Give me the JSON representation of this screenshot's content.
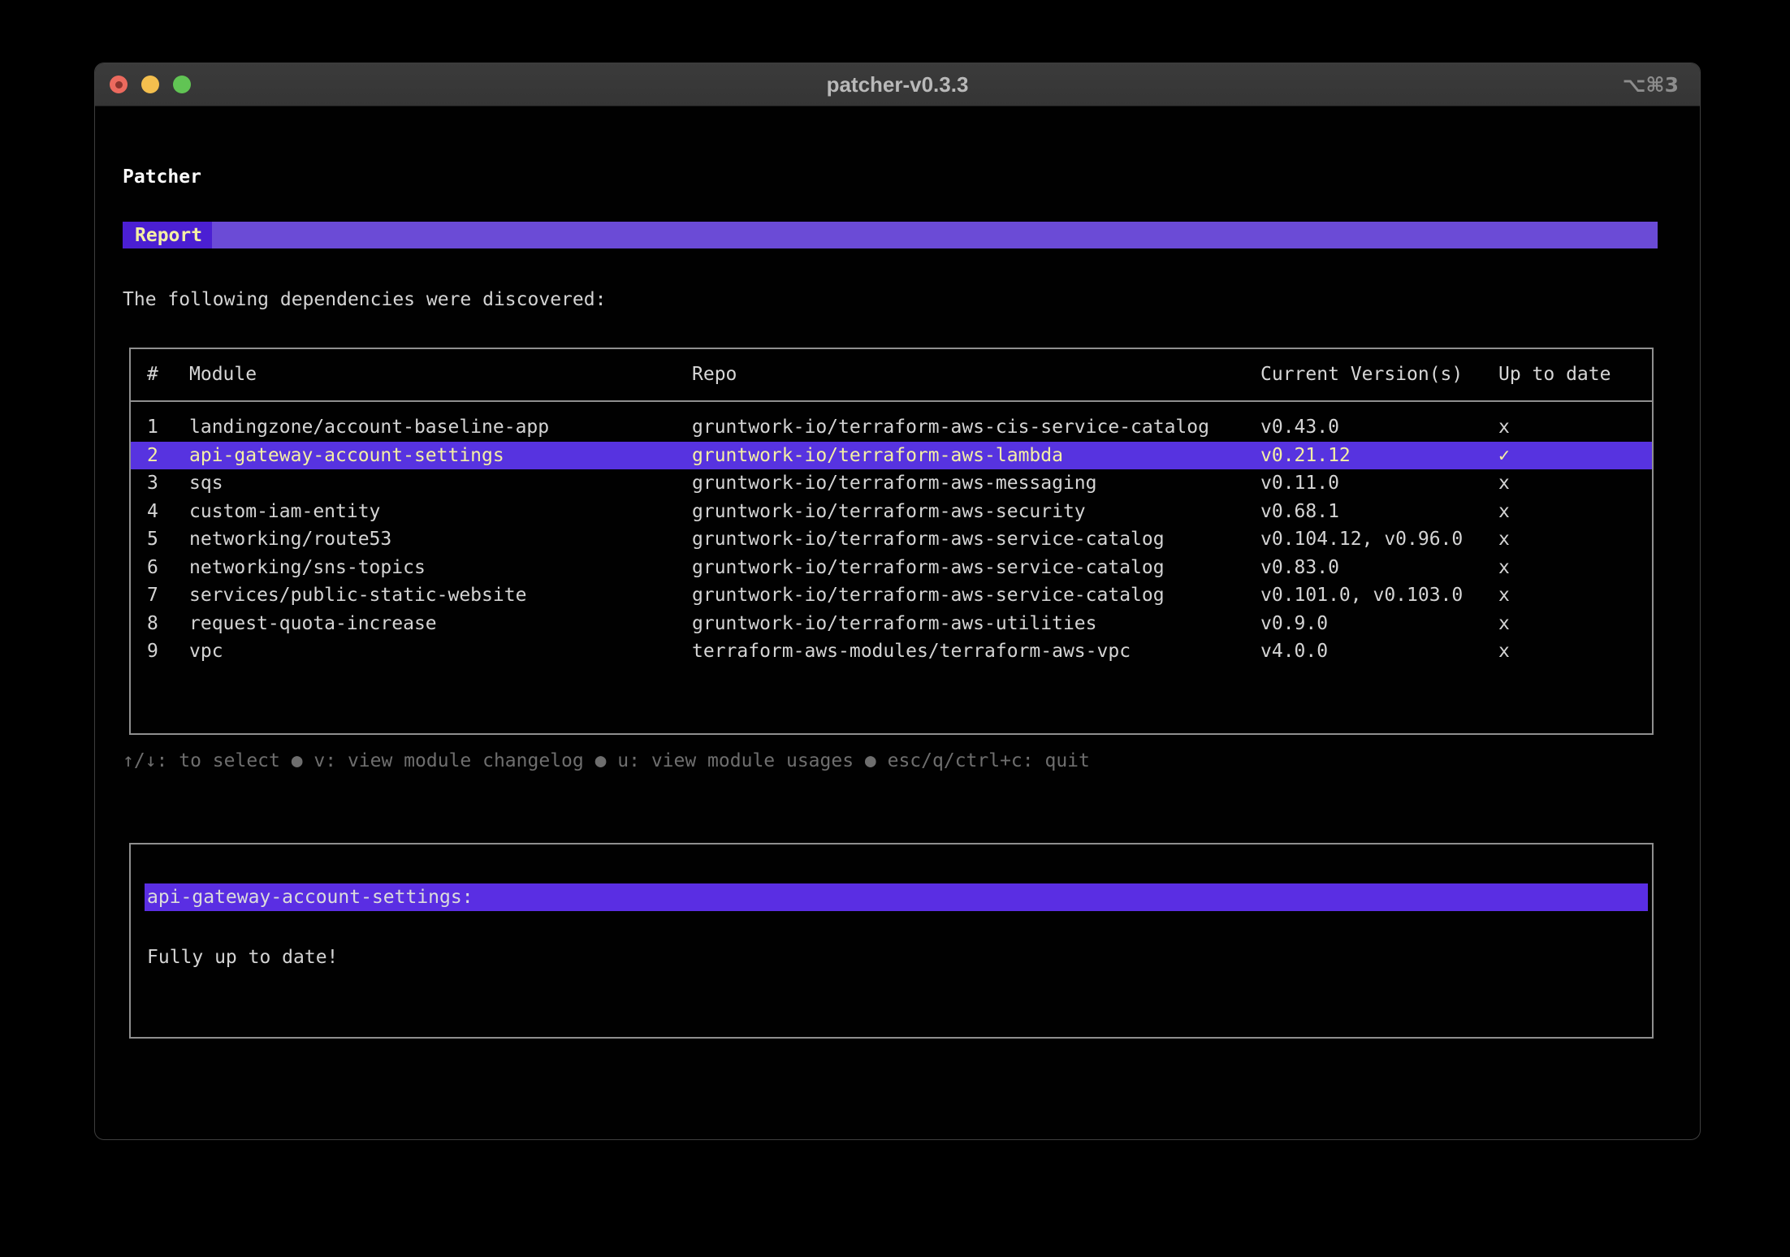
{
  "window": {
    "title": "patcher-v0.3.3",
    "shortcut_hint": "⌥⌘3"
  },
  "app": {
    "heading": "Patcher",
    "tab_label": "Report",
    "intro": "The following dependencies were discovered:"
  },
  "table": {
    "columns": [
      "#",
      "Module",
      "Repo",
      "Current Version(s)",
      "Up to date"
    ],
    "rows": [
      {
        "num": "1",
        "module": "landingzone/account-baseline-app",
        "repo": "gruntwork-io/terraform-aws-cis-service-catalog",
        "versions": "v0.43.0",
        "up_to_date": "x",
        "selected": false
      },
      {
        "num": "2",
        "module": "api-gateway-account-settings",
        "repo": "gruntwork-io/terraform-aws-lambda",
        "versions": "v0.21.12",
        "up_to_date": "✓",
        "selected": true
      },
      {
        "num": "3",
        "module": "sqs",
        "repo": "gruntwork-io/terraform-aws-messaging",
        "versions": "v0.11.0",
        "up_to_date": "x",
        "selected": false
      },
      {
        "num": "4",
        "module": "custom-iam-entity",
        "repo": "gruntwork-io/terraform-aws-security",
        "versions": "v0.68.1",
        "up_to_date": "x",
        "selected": false
      },
      {
        "num": "5",
        "module": "networking/route53",
        "repo": "gruntwork-io/terraform-aws-service-catalog",
        "versions": "v0.104.12, v0.96.0",
        "up_to_date": "x",
        "selected": false
      },
      {
        "num": "6",
        "module": "networking/sns-topics",
        "repo": "gruntwork-io/terraform-aws-service-catalog",
        "versions": "v0.83.0",
        "up_to_date": "x",
        "selected": false
      },
      {
        "num": "7",
        "module": "services/public-static-website",
        "repo": "gruntwork-io/terraform-aws-service-catalog",
        "versions": "v0.101.0, v0.103.0",
        "up_to_date": "x",
        "selected": false
      },
      {
        "num": "8",
        "module": "request-quota-increase",
        "repo": "gruntwork-io/terraform-aws-utilities",
        "versions": "v0.9.0",
        "up_to_date": "x",
        "selected": false
      },
      {
        "num": "9",
        "module": "vpc",
        "repo": "terraform-aws-modules/terraform-aws-vpc",
        "versions": "v4.0.0",
        "up_to_date": "x",
        "selected": false
      }
    ]
  },
  "help": {
    "text": "↑/↓: to select ● v: view module changelog ● u: view module usages ● esc/q/ctrl+c: quit"
  },
  "detail": {
    "heading": "api-gateway-account-settings:",
    "body": "Fully up to date!"
  },
  "colors": {
    "accent_tab": "#4B1FD3",
    "accent_bar": "#6B4BD6",
    "row_highlight": "#5733E0",
    "detail_highlight": "#5A2EE3",
    "highlight_text": "#F4EFA4",
    "help_text": "#6E6E6E",
    "border": "#8F8F8F",
    "traffic_red": "#EC6A5E",
    "traffic_yellow": "#F4BF4E",
    "traffic_green": "#61C454"
  }
}
